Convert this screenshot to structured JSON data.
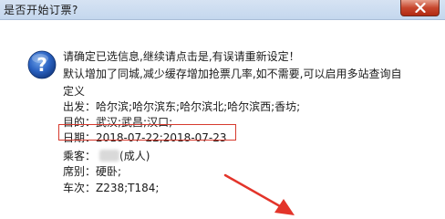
{
  "window": {
    "title": "是否开始订票?"
  },
  "message": {
    "line1": "请确定已选信息,继续请点击是,有误请重新设定！",
    "line2": "默认增加了同城,减少缓存增加抢票几率,如不需要,可以启用多站查询自",
    "line3": "定义",
    "departure": "出发：哈尔滨;哈尔滨东;哈尔滨北;哈尔滨西;香坊;",
    "destination": "目的：武汉;武昌;汉口;",
    "date": "日期：2018-07-22;2018-07-23",
    "passenger_label": "乘客：",
    "passenger_suffix": "(成人)",
    "seat": "席别：硬卧;",
    "trains": "车次：Z238;T184;"
  },
  "colors": {
    "highlight": "#d63a2e",
    "arrow": "#e3342a",
    "titlebar": "#c4d7ee"
  },
  "icons": {
    "dialog": "question-icon",
    "close": "close-icon"
  }
}
